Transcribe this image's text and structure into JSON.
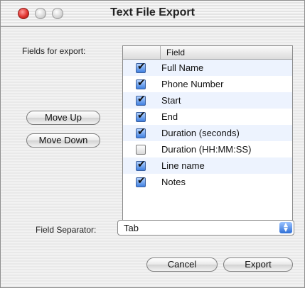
{
  "window": {
    "title": "Text File Export"
  },
  "fields_label": "Fields for export:",
  "table": {
    "header": "Field",
    "rows": [
      {
        "label": "Full Name",
        "checked": true
      },
      {
        "label": "Phone Number",
        "checked": true
      },
      {
        "label": "Start",
        "checked": true
      },
      {
        "label": "End",
        "checked": true
      },
      {
        "label": "Duration (seconds)",
        "checked": true
      },
      {
        "label": "Duration (HH:MM:SS)",
        "checked": false
      },
      {
        "label": "Line name",
        "checked": true
      },
      {
        "label": "Notes",
        "checked": true
      }
    ]
  },
  "buttons": {
    "move_up": "Move Up",
    "move_down": "Move Down",
    "cancel": "Cancel",
    "export": "Export"
  },
  "separator": {
    "label": "Field Separator:",
    "selected": "Tab"
  }
}
